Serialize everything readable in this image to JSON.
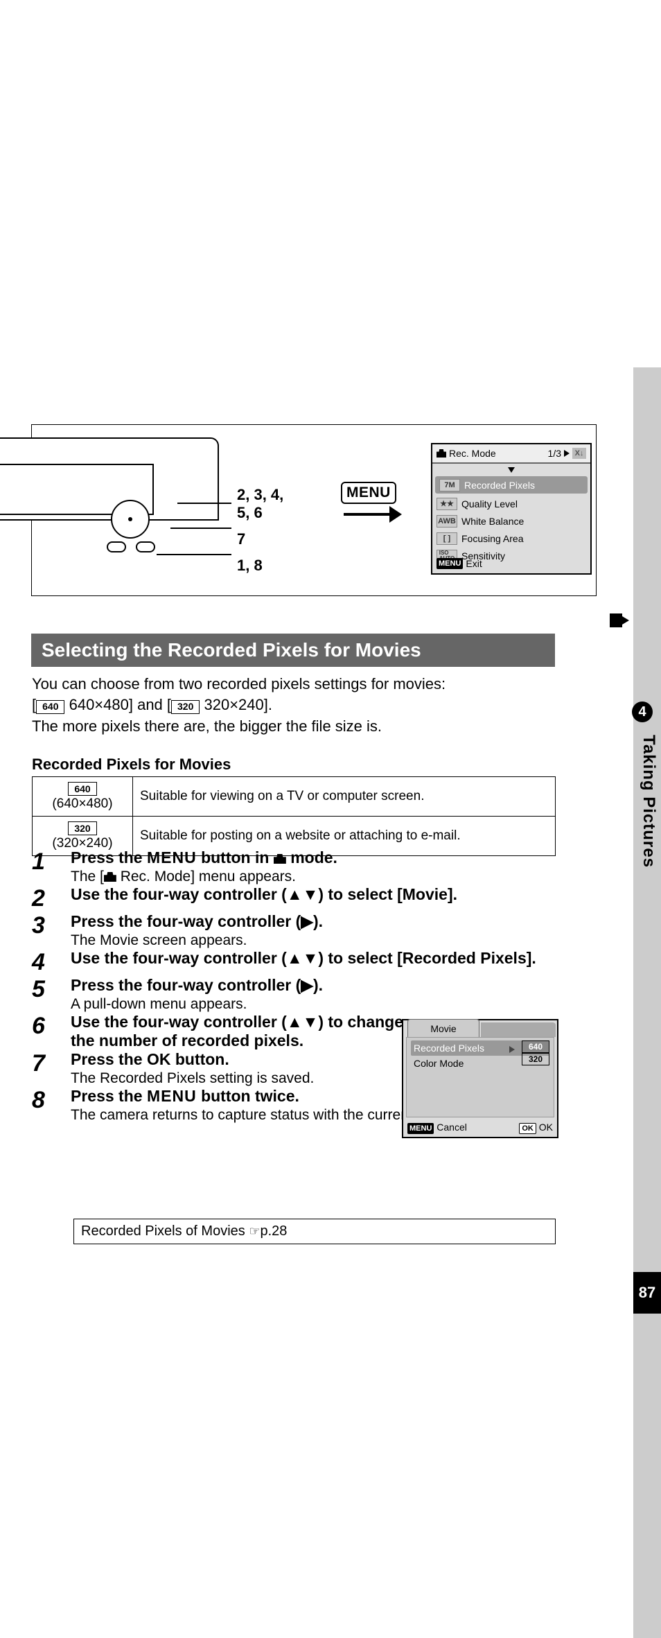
{
  "chapter_number": "4",
  "side_label": "Taking Pictures",
  "page_number": "87",
  "diagram": {
    "leads": {
      "top": "2, 3, 4,\n5, 6",
      "mid": "7",
      "bot": "1, 8"
    },
    "menu_badge": "MENU"
  },
  "lcd1": {
    "title_left": "Rec. Mode",
    "page_indicator": "1/3",
    "x_tag": "X↓",
    "rows": [
      {
        "tag": "7M",
        "label": "Recorded Pixels"
      },
      {
        "tag": "★★",
        "label": "Quality Level"
      },
      {
        "tag": "AWB",
        "label": "White Balance"
      },
      {
        "tag": "[ ]",
        "label": "Focusing Area"
      },
      {
        "tag": "ISO\nAUTO",
        "label": "Sensitivity"
      }
    ],
    "foot_menu": "MENU",
    "foot_label": "Exit"
  },
  "section_title": "Selecting the Recorded Pixels for Movies",
  "intro": {
    "line1a": "You can choose from two recorded pixels settings for movies:",
    "chip1": "640",
    "opt1": " 640×480] and [",
    "chip2": "320",
    "opt2": " 320×240].",
    "line2": "The more pixels there are, the bigger the file size is."
  },
  "subhead": "Recorded Pixels for Movies",
  "table": [
    {
      "chip": "640",
      "res": "(640×480)",
      "desc": "Suitable for viewing on a TV or computer screen."
    },
    {
      "chip": "320",
      "res": "(320×240)",
      "desc": "Suitable for posting on a website or attaching to e-mail."
    }
  ],
  "steps": [
    {
      "n": "1",
      "big_pre": "Press the ",
      "big_b": "MENU",
      "big_post": " button in ",
      "big_post2": " mode.",
      "sm_pre": "The [",
      "sm_post": " Rec. Mode] menu appears."
    },
    {
      "n": "2",
      "big": "Use the four-way controller (▲▼) to select [Movie]."
    },
    {
      "n": "3",
      "big": "Press the four-way controller (▶).",
      "sm": "The Movie screen appears."
    },
    {
      "n": "4",
      "big": "Use the four-way controller (▲▼) to select [Recorded Pixels]."
    },
    {
      "n": "5",
      "big": "Press the four-way controller (▶).",
      "sm": "A pull-down menu appears."
    },
    {
      "n": "6",
      "big": "Use the four-way controller (▲▼) to change the number of recorded pixels."
    },
    {
      "n": "7",
      "big_pre": "Press the ",
      "big_b": "OK",
      "big_post": " button.",
      "sm": "The Recorded Pixels setting is saved."
    },
    {
      "n": "8",
      "big_pre": "Press the ",
      "big_b": "MENU",
      "big_post": " button twice.",
      "sm": "The camera returns to capture status with the current setting."
    }
  ],
  "lcd2": {
    "tab": "Movie",
    "rows": [
      {
        "label": "Recorded Pixels",
        "sel": true
      },
      {
        "label": "Color Mode"
      }
    ],
    "opts": [
      "640",
      "320"
    ],
    "foot_menu": "MENU",
    "foot_cancel": "Cancel",
    "foot_ok_tag": "OK",
    "foot_ok": "OK"
  },
  "ref": {
    "text": "Recorded Pixels of Movies ",
    "page": "p.28"
  }
}
